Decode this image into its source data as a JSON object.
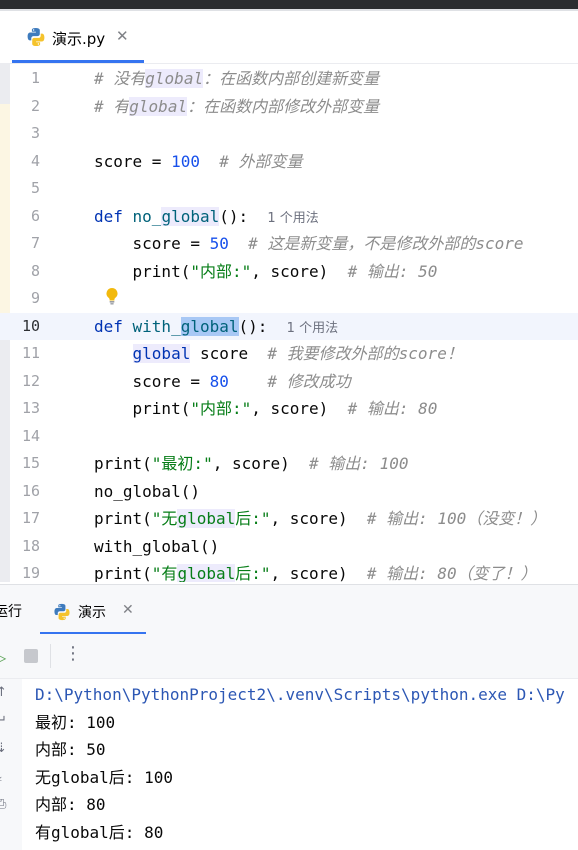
{
  "editor_tab": {
    "filename": "演示.py",
    "close_glyph": "✕",
    "icon": "python-icon"
  },
  "editor": {
    "current_line": 10,
    "lines": [
      {
        "n": "1",
        "parts": [
          [
            "cm",
            "# 没有"
          ],
          [
            "cm hl",
            "global"
          ],
          [
            "cm",
            "：在函数内部创建新变量"
          ]
        ]
      },
      {
        "n": "2",
        "parts": [
          [
            "cm",
            "# 有"
          ],
          [
            "cm hl",
            "global"
          ],
          [
            "cm",
            "：在函数内部修改外部变量"
          ]
        ]
      },
      {
        "n": "3",
        "parts": []
      },
      {
        "n": "4",
        "parts": [
          [
            "",
            "score = "
          ],
          [
            "num",
            "100"
          ],
          [
            "",
            "  "
          ],
          [
            "cm",
            "# 外部变量"
          ]
        ]
      },
      {
        "n": "5",
        "parts": []
      },
      {
        "n": "6",
        "parts": [
          [
            "kw",
            "def "
          ],
          [
            "fn",
            "no_"
          ],
          [
            "fn hl",
            "global"
          ],
          [
            "",
            "():  "
          ],
          [
            "usage",
            "1 个用法"
          ]
        ]
      },
      {
        "n": "7",
        "parts": [
          [
            "",
            "    score = "
          ],
          [
            "num",
            "50"
          ],
          [
            "",
            "  "
          ],
          [
            "cm",
            "# 这是新变量，不是修改外部的score"
          ]
        ]
      },
      {
        "n": "8",
        "parts": [
          [
            "",
            "    print("
          ],
          [
            "str",
            "\"内部:\""
          ],
          [
            "",
            ", score)  "
          ],
          [
            "cm",
            "# 输出: 50"
          ]
        ]
      },
      {
        "n": "9",
        "parts": []
      },
      {
        "n": "10",
        "parts": [
          [
            "kw",
            "def "
          ],
          [
            "fn",
            "with_"
          ],
          [
            "fn sel",
            "global"
          ],
          [
            "",
            "():  "
          ],
          [
            "usage",
            "1 个用法"
          ]
        ]
      },
      {
        "n": "11",
        "parts": [
          [
            "",
            "    "
          ],
          [
            "kw hl",
            "global"
          ],
          [
            "",
            " score  "
          ],
          [
            "cm",
            "# 我要修改外部的score！"
          ]
        ]
      },
      {
        "n": "12",
        "parts": [
          [
            "",
            "    score = "
          ],
          [
            "num",
            "80"
          ],
          [
            "",
            "    "
          ],
          [
            "cm",
            "# 修改成功"
          ]
        ]
      },
      {
        "n": "13",
        "parts": [
          [
            "",
            "    print("
          ],
          [
            "str",
            "\"内部:\""
          ],
          [
            "",
            ", score)  "
          ],
          [
            "cm",
            "# 输出: 80"
          ]
        ]
      },
      {
        "n": "14",
        "parts": []
      },
      {
        "n": "15",
        "parts": [
          [
            "",
            "print("
          ],
          [
            "str",
            "\"最初:\""
          ],
          [
            "",
            ", score)  "
          ],
          [
            "cm",
            "# 输出: 100"
          ]
        ]
      },
      {
        "n": "16",
        "parts": [
          [
            "",
            "no_global()"
          ]
        ]
      },
      {
        "n": "17",
        "parts": [
          [
            "",
            "print("
          ],
          [
            "str",
            "\"无"
          ],
          [
            "str hl",
            "global"
          ],
          [
            "str",
            "后:\""
          ],
          [
            "",
            ", score)  "
          ],
          [
            "cm",
            "# 输出: 100（没变！）"
          ]
        ]
      },
      {
        "n": "18",
        "parts": [
          [
            "",
            "with_global()"
          ]
        ]
      },
      {
        "n": "19",
        "parts": [
          [
            "",
            "print("
          ],
          [
            "str",
            "\"有"
          ],
          [
            "str hl",
            "global"
          ],
          [
            "str",
            "后:\""
          ],
          [
            "",
            ", score)  "
          ],
          [
            "cm",
            "# 输出: 80（变了！）"
          ]
        ]
      }
    ]
  },
  "run_window": {
    "label": "运行",
    "tab_title": "演示",
    "close_glyph": "✕",
    "more_glyph": "⋮",
    "rerun_icon": "rerun-icon",
    "stop_icon": "stop-icon"
  },
  "console": {
    "lines": [
      {
        "text": "D:\\Python\\PythonProject2\\.venv\\Scripts\\python.exe D:\\Py",
        "kind": "cmd"
      },
      {
        "text": "最初: 100",
        "kind": "out"
      },
      {
        "text": "内部: 50",
        "kind": "out"
      },
      {
        "text": "无global后: 100",
        "kind": "out"
      },
      {
        "text": "内部: 80",
        "kind": "out"
      },
      {
        "text": "有global后: 80",
        "kind": "out"
      }
    ]
  },
  "colors": {
    "accent": "#3574f0",
    "keyword": "#0033b3",
    "number": "#1750eb",
    "string": "#067d17",
    "comment": "#8c8c8c",
    "function": "#00627a",
    "current_line_bg": "#f2f5fd",
    "highlight_bg": "#edebfc",
    "selection_bg": "#a8c8f5"
  }
}
